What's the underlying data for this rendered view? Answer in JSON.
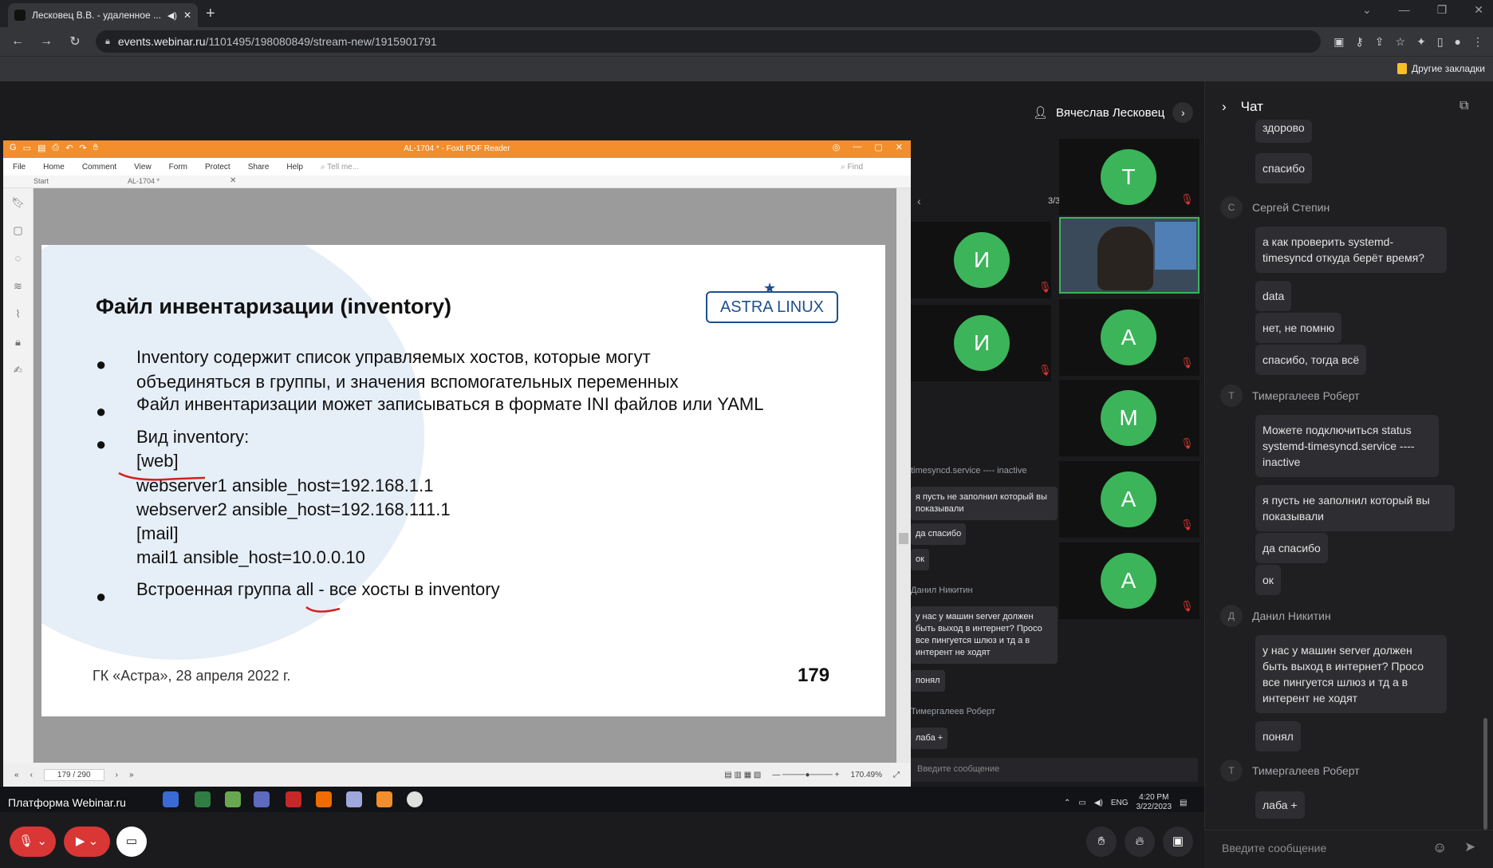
{
  "browser": {
    "tab_title": "Лесковец В.В. - удаленное ...",
    "url_host": "events.webinar.ru",
    "url_path": "/1101495/198080849/stream-new/1915901791",
    "bookmarks_label": "Другие закладки",
    "newtab": "+"
  },
  "webinar": {
    "presenter_name": "Вячеслав Лесковец",
    "platform_label": "Платформа Webinar.ru",
    "participants_page": "3/3"
  },
  "foxit": {
    "title": "AL-1704 * - Foxit PDF Reader",
    "menu": [
      "File",
      "Home",
      "Comment",
      "View",
      "Form",
      "Protect",
      "Share",
      "Help"
    ],
    "tell_me": "Tell me...",
    "find": "Find",
    "tab_start": "Start",
    "tab_doc": "AL-1704 *",
    "page_indicator": "179 / 290",
    "zoom": "170.49%"
  },
  "slide": {
    "title": "Файл инвентаризации (inventory)",
    "logo": "ASTRA LINUX",
    "bullets": [
      "Inventory содержит список управляемых хостов, которые могут",
      "объединяться в группы, и значения вспомогательных переменных",
      "Файл инвентаризации может записываться в формате INI файлов или YAML",
      "Вид inventory:",
      "[web]",
      "webserver1 ansible_host=192.168.1.1",
      "webserver2 ansible_host=192.168.111.1",
      "[mail]",
      "mail1 ansible_host=10.0.0.10",
      "Встроенная группа all - все хосты в inventory"
    ],
    "footer": "ГК «Астра», 28 апреля 2022 г.",
    "page_number": "179"
  },
  "participants": [
    {
      "initial": "T",
      "color": "#3cb45a"
    },
    {
      "initial": "И",
      "color": "#3cb45a"
    },
    {
      "initial": "И",
      "color": "#3cb45a"
    },
    {
      "initial": "A",
      "color": "#3cb45a"
    },
    {
      "initial": "M",
      "color": "#3cb45a"
    },
    {
      "initial": "A",
      "color": "#3cb45a"
    },
    {
      "initial": "A",
      "color": "#3cb45a"
    }
  ],
  "mini_chat": {
    "messages": [
      "timesyncd.service ---- inactive",
      "я пусть не заполнил который вы показывали",
      "да спасибо",
      "ок",
      "у нас у машин server должен быть выход в интернет? Просо все пингуется шлюз и тд а в интерент не ходят",
      "понял",
      "лаба +"
    ],
    "names": [
      "Данил Никитин",
      "Тимергалеев Роберт"
    ],
    "input_placeholder": "Введите сообщение"
  },
  "taskbar": {
    "lang": "ENG",
    "time": "4:20 PM",
    "date": "3/22/2023"
  },
  "chat": {
    "title": "Чат",
    "messages": [
      {
        "type": "bubble",
        "text": "здорово"
      },
      {
        "type": "bubble",
        "text": "спасибо"
      },
      {
        "type": "name",
        "initial": "С",
        "text": "Сергей Степин"
      },
      {
        "type": "bubble",
        "text": "а как проверить systemd-timesyncd откуда берёт время?"
      },
      {
        "type": "bubble",
        "text": "data"
      },
      {
        "type": "bubble",
        "text": "нет, не помню"
      },
      {
        "type": "bubble",
        "text": "спасибо, тогда всё"
      },
      {
        "type": "name",
        "initial": "Т",
        "text": "Тимергалеев Роберт"
      },
      {
        "type": "bubble",
        "text": "Можете подключиться status systemd-timesyncd.service ---- inactive"
      },
      {
        "type": "bubble",
        "text": "я пусть не заполнил который вы показывали"
      },
      {
        "type": "bubble",
        "text": "да спасибо"
      },
      {
        "type": "bubble",
        "text": "ок"
      },
      {
        "type": "name",
        "initial": "Д",
        "text": "Данил Никитин"
      },
      {
        "type": "bubble",
        "text": "у нас у машин server должен быть выход в интернет? Просо все пингуется шлюз и тд а в интерент не ходят"
      },
      {
        "type": "bubble",
        "text": "понял"
      },
      {
        "type": "name",
        "initial": "Т",
        "text": "Тимергалеев Роберт"
      },
      {
        "type": "bubble",
        "text": "лаба +"
      }
    ],
    "input_placeholder": "Введите сообщение"
  }
}
